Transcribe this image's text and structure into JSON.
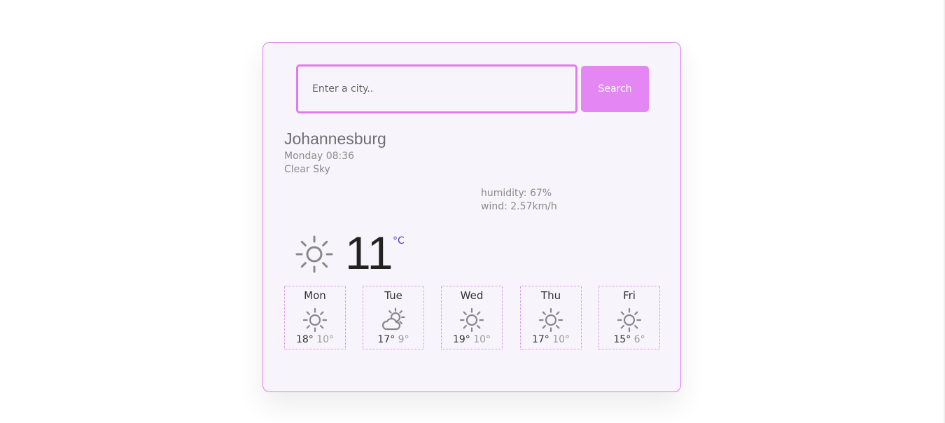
{
  "search": {
    "placeholder": "Enter a city..",
    "value": "",
    "button_label": "Search"
  },
  "current": {
    "city": "Johannesburg",
    "datetime": "Monday 08:36",
    "description": "Clear Sky",
    "humidity": "humidity: 67%",
    "wind": "wind: 2.57km/h",
    "temperature": "11",
    "unit": "°C",
    "icon": "sun-icon"
  },
  "forecast": [
    {
      "day": "Mon",
      "max": "18°",
      "min": "10°",
      "icon": "sun-icon"
    },
    {
      "day": "Tue",
      "max": "17°",
      "min": "9°",
      "icon": "sun-cloud-icon"
    },
    {
      "day": "Wed",
      "max": "19°",
      "min": "10°",
      "icon": "sun-icon"
    },
    {
      "day": "Thu",
      "max": "17°",
      "min": "10°",
      "icon": "sun-icon"
    },
    {
      "day": "Fri",
      "max": "15°",
      "min": "6°",
      "icon": "sun-icon"
    }
  ],
  "colors": {
    "accent": "#e27bf0",
    "button": "#e487f5",
    "card_background": "#f7f5fb",
    "unit": "#4a3fd0",
    "icon": "#888888"
  }
}
